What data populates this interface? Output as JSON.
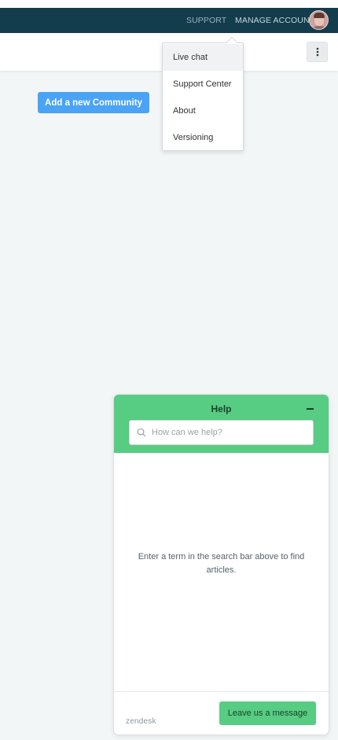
{
  "topbar": {
    "support_label": "SUPPORT",
    "manage_account_label": "MANAGE ACCOUNT",
    "avatar": "user-avatar"
  },
  "subheader": {
    "menu_icon": "kebab-menu-icon"
  },
  "main": {
    "add_community_label": "Add a new Community"
  },
  "dropdown": {
    "items": [
      {
        "label": "Live chat"
      },
      {
        "label": "Support Center"
      },
      {
        "label": "About"
      },
      {
        "label": "Versioning"
      }
    ]
  },
  "help_widget": {
    "title": "Help",
    "search_placeholder": "How can we help?",
    "empty_message": "Enter a term in the search bar above to find articles.",
    "brand": "zendesk",
    "leave_message_label": "Leave us a message",
    "accent_color": "#56cd82"
  },
  "colors": {
    "topbar": "#133d4d",
    "primary_button": "#4aa3f5",
    "background": "#f3f6f7"
  }
}
